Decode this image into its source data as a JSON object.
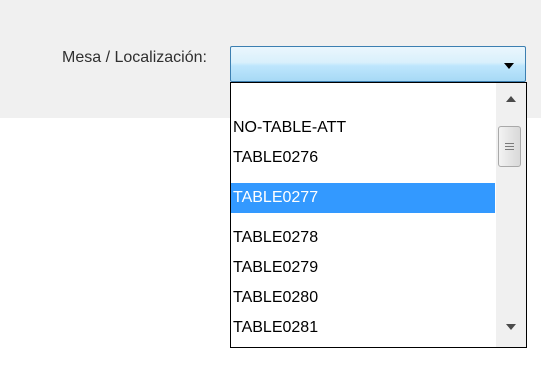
{
  "form": {
    "field_label": "Mesa / Localización:",
    "combo_value": ""
  },
  "dropdown": {
    "items": [
      {
        "label": ""
      },
      {
        "label": "NO-TABLE-ATT"
      },
      {
        "label": "TABLE0276"
      },
      {
        "label": "TABLE0277"
      },
      {
        "label": "TABLE0278"
      },
      {
        "label": "TABLE0279"
      },
      {
        "label": "TABLE0280"
      },
      {
        "label": "TABLE0281"
      }
    ],
    "selected_index": 3,
    "scroll_position": 0.12
  },
  "icons": {
    "combo_arrow": "triangle-down-icon",
    "scroll_up": "triangle-up-icon",
    "scroll_down": "triangle-down-icon",
    "thumb_grip": "grip-lines-icon"
  },
  "colors": {
    "selection": "#3399ff",
    "combo_border": "#3c7fb1"
  }
}
